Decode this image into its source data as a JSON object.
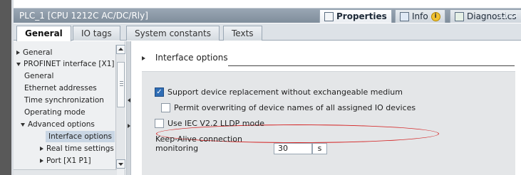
{
  "window": {
    "title": "PLC_1 [CPU 1212C AC/DC/Rly]",
    "inspector_tabs": [
      {
        "label": "Properties",
        "icon": "properties-icon",
        "active": true
      },
      {
        "label": "Info",
        "icon": "info-icon",
        "active": false
      },
      {
        "label": "Diagnostics",
        "icon": "diagnostics-icon",
        "active": false
      }
    ]
  },
  "tabs": [
    {
      "label": "General",
      "active": true
    },
    {
      "label": "IO tags",
      "active": false
    },
    {
      "label": "System constants",
      "active": false
    },
    {
      "label": "Texts",
      "active": false
    }
  ],
  "nav": {
    "items": [
      {
        "label": "General",
        "level": 0,
        "expander": "collapsed"
      },
      {
        "label": "PROFINET interface [X1]",
        "level": 0,
        "expander": "expanded"
      },
      {
        "label": "General",
        "level": 1
      },
      {
        "label": "Ethernet addresses",
        "level": 1
      },
      {
        "label": "Time synchronization",
        "level": 1
      },
      {
        "label": "Operating mode",
        "level": 1
      },
      {
        "label": "Advanced options",
        "level": 1,
        "expander": "expanded"
      },
      {
        "label": "Interface options",
        "level": 2,
        "selected": true
      },
      {
        "label": "Real time settings",
        "level": 2,
        "expander": "collapsed"
      },
      {
        "label": "Port [X1 P1]",
        "level": 2,
        "expander": "collapsed"
      }
    ]
  },
  "content": {
    "section_title": "Interface options",
    "options": [
      {
        "label": "Support device replacement without exchangeable medium",
        "checked": true
      },
      {
        "label": "Permit overwriting of device names of all assigned IO devices",
        "checked": false,
        "highlighted": true
      },
      {
        "label": "Use IEC V2.2 LLDP mode",
        "checked": false
      }
    ],
    "keep_alive": {
      "label_line1": "Keep-Alive connection",
      "label_line2": "monitoring",
      "value": "30",
      "unit": "s"
    }
  },
  "colors": {
    "title_bar": "#8d9aa8",
    "selected_nav": "#c9d6e4",
    "checkbox_checked": "#2f6db5",
    "highlight_ellipse": "#d41f1f",
    "panel": "#e4e6e8"
  }
}
